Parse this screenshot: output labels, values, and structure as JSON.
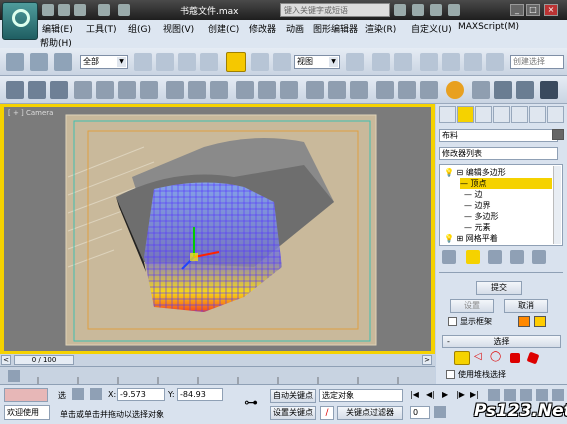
{
  "titlebar": {
    "title": "书蔻文件.max",
    "search_placeholder": "键入关键字或短语"
  },
  "menu": {
    "items": [
      "编辑(E)",
      "工具(T)",
      "组(G)",
      "视图(V)",
      "创建(C)",
      "修改器",
      "动画",
      "图形编辑器",
      "渲染(R)",
      "自定义(U)",
      "MAXScript(M)",
      "帮助(H)"
    ]
  },
  "toolbar": {
    "selection_filter": "全部",
    "reference_coord": "视图",
    "named_selection": "创建选择"
  },
  "viewport": {
    "label": "[ + ] Camera"
  },
  "panel": {
    "object_name": "布料",
    "modifier_list": "修改器列表",
    "stack": {
      "editable_poly": "编辑多边形",
      "vertex": "顶点",
      "edge": "边",
      "border": "边界",
      "polygon": "多边形",
      "element": "元素",
      "grid_plane": "网格平着"
    },
    "submit_button": "提交",
    "settings_button": "设置",
    "cancel_button": "取消",
    "show_frame_label": "显示框架",
    "selection_rollout": "选择",
    "use_stack_selection": "使用堆栈选择",
    "swatch_colors": [
      "#ff8800",
      "#ffcc00"
    ],
    "accent": "#f5d200"
  },
  "timeline": {
    "frame_label": "0 / 100"
  },
  "status": {
    "selected_label": "选",
    "x_label": "X:",
    "x_value": "-9.573",
    "y_label": "Y:",
    "y_value": "-84.93",
    "auto_key": "自动关键点",
    "set_key": "设置关键点",
    "selected_object": "选定对象",
    "key_filters": "关键点过滤器",
    "welcome": "欢迎使用",
    "prompt": "单击或单击并拖动以选择对象",
    "frame_value": "0"
  },
  "watermark": {
    "text": "Ps123.Net"
  }
}
